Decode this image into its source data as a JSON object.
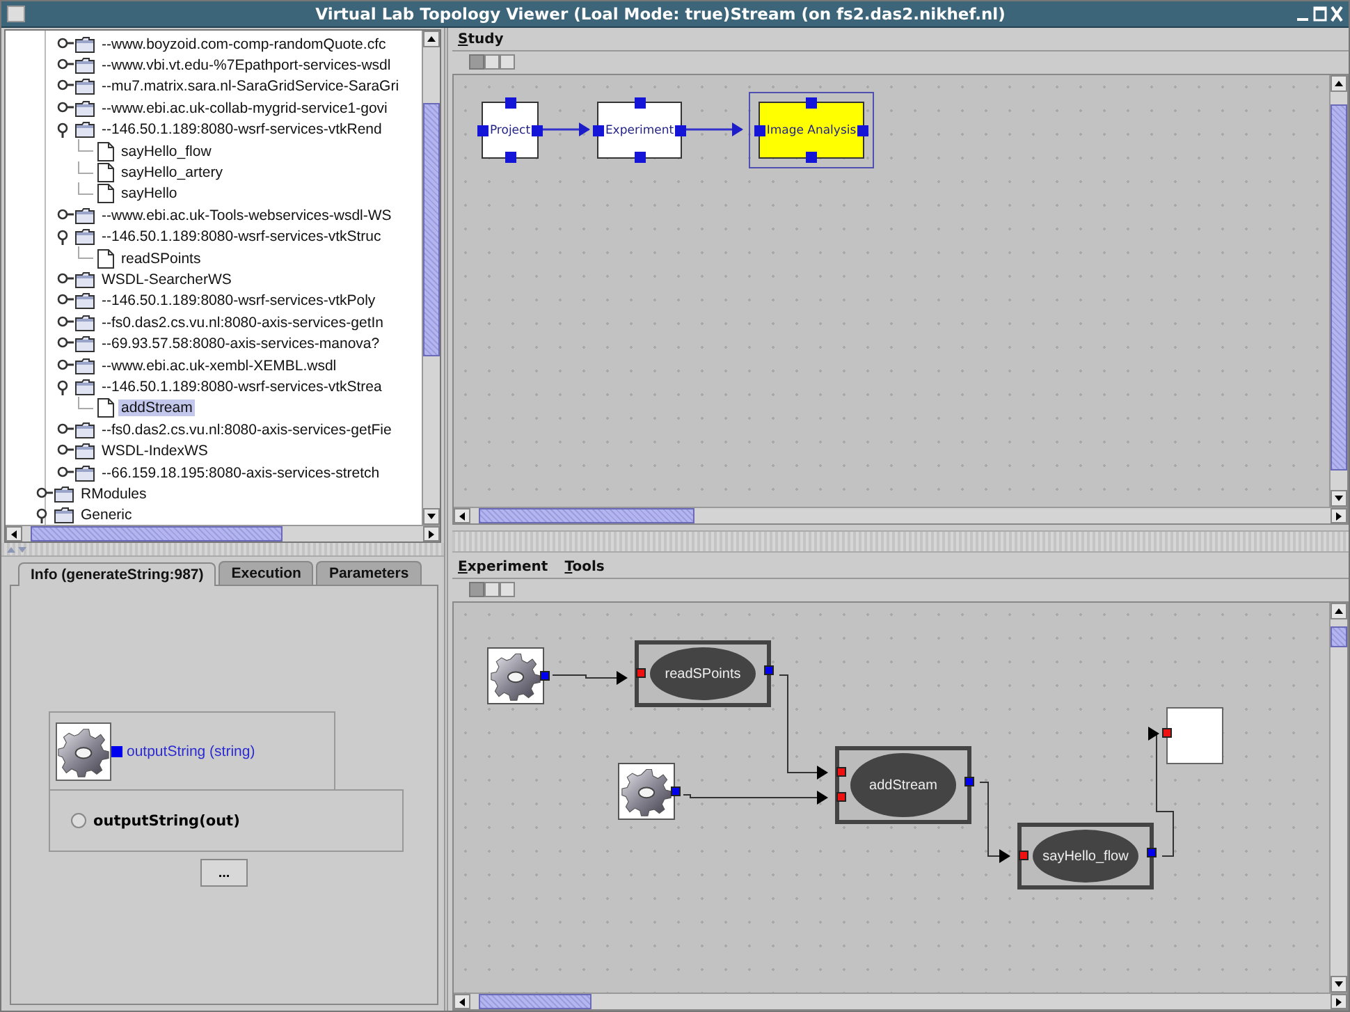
{
  "window": {
    "title": "Virtual Lab Topology Viewer (Loal Mode: true)Stream (on fs2.das2.nikhef.nl)"
  },
  "tree": {
    "items": [
      {
        "children": [
          {
            "label": "--www.boyzoid.com-comp-randomQuote.cfc",
            "kind": "folder",
            "expanded": false,
            "selected": false
          },
          {
            "label": "--www.vbi.vt.edu-%7Epathport-services-wsdl",
            "kind": "folder",
            "expanded": false,
            "selected": false
          },
          {
            "label": "--mu7.matrix.sara.nl-SaraGridService-SaraGri",
            "kind": "folder",
            "expanded": false,
            "selected": false
          },
          {
            "label": "--www.ebi.ac.uk-collab-mygrid-service1-govi",
            "kind": "folder",
            "expanded": false,
            "selected": false
          },
          {
            "label": "--146.50.1.189:8080-wsrf-services-vtkRend",
            "kind": "folder",
            "expanded": true,
            "selected": false,
            "children": [
              {
                "label": "sayHello_flow",
                "kind": "file",
                "selected": false
              },
              {
                "label": "sayHello_artery",
                "kind": "file",
                "selected": false
              },
              {
                "label": "sayHello",
                "kind": "file",
                "selected": false
              }
            ]
          },
          {
            "label": "--www.ebi.ac.uk-Tools-webservices-wsdl-WS",
            "kind": "folder",
            "expanded": false,
            "selected": false
          },
          {
            "label": "--146.50.1.189:8080-wsrf-services-vtkStruc",
            "kind": "folder",
            "expanded": true,
            "selected": false,
            "children": [
              {
                "label": "readSPoints",
                "kind": "file",
                "selected": false
              }
            ]
          },
          {
            "label": "WSDL-SearcherWS",
            "kind": "folder",
            "expanded": false,
            "selected": false
          },
          {
            "label": "--146.50.1.189:8080-wsrf-services-vtkPoly",
            "kind": "folder",
            "expanded": false,
            "selected": false
          },
          {
            "label": "--fs0.das2.cs.vu.nl:8080-axis-services-getIn",
            "kind": "folder",
            "expanded": false,
            "selected": false
          },
          {
            "label": "--69.93.57.58:8080-axis-services-manova?",
            "kind": "folder",
            "expanded": false,
            "selected": false
          },
          {
            "label": "--www.ebi.ac.uk-xembl-XEMBL.wsdl",
            "kind": "folder",
            "expanded": false,
            "selected": false
          },
          {
            "label": "--146.50.1.189:8080-wsrf-services-vtkStrea",
            "kind": "folder",
            "expanded": true,
            "selected": false,
            "children": [
              {
                "label": "addStream",
                "kind": "file",
                "selected": true
              }
            ]
          },
          {
            "label": "--fs0.das2.cs.vu.nl:8080-axis-services-getFie",
            "kind": "folder",
            "expanded": false,
            "selected": false
          },
          {
            "label": "WSDL-IndexWS",
            "kind": "folder",
            "expanded": false,
            "selected": false
          },
          {
            "label": "--66.159.18.195:8080-axis-services-stretch",
            "kind": "folder",
            "expanded": false,
            "selected": false
          }
        ]
      },
      {
        "label": "RModules",
        "kind": "folder",
        "expanded": false,
        "selected": false
      },
      {
        "label": "Generic",
        "kind": "folder",
        "expanded": true,
        "selected": false
      }
    ]
  },
  "tabs": [
    {
      "label": "Info (generateString:987)",
      "selected": true
    },
    {
      "label": "Execution",
      "selected": false
    },
    {
      "label": "Parameters",
      "selected": false
    }
  ],
  "info": {
    "port_label": "outputString (string)",
    "output": {
      "label": "outputString(out)",
      "checked": false
    },
    "button": "..."
  },
  "study": {
    "menu": [
      "Study"
    ],
    "nodes": [
      {
        "label": "Project",
        "selected": false
      },
      {
        "label": "Experiment",
        "selected": false
      },
      {
        "label": "Image Analysis",
        "selected": true
      }
    ]
  },
  "experiment": {
    "menu": [
      "Experiment",
      "Tools"
    ],
    "nodes": [
      {
        "kind": "gear"
      },
      {
        "kind": "service",
        "label": "readSPoints"
      },
      {
        "kind": "gear"
      },
      {
        "kind": "service",
        "label": "addStream"
      },
      {
        "kind": "service",
        "label": "sayHello_flow"
      },
      {
        "kind": "output"
      }
    ]
  }
}
